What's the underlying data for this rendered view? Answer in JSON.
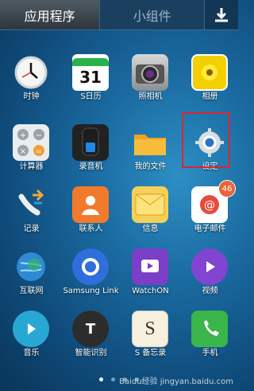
{
  "tabs": [
    "应用程序",
    "小组件"
  ],
  "apps": [
    {
      "label": "时钟",
      "icon": "clock-icon"
    },
    {
      "label": "S日历",
      "icon": "calendar-icon",
      "icon_text": "31"
    },
    {
      "label": "照相机",
      "icon": "camera-icon"
    },
    {
      "label": "相册",
      "icon": "gallery-icon"
    },
    {
      "label": "计算器",
      "icon": "calculator-icon"
    },
    {
      "label": "录音机",
      "icon": "recorder-icon"
    },
    {
      "label": "我的文件",
      "icon": "folder-icon"
    },
    {
      "label": "设定",
      "icon": "settings-icon"
    },
    {
      "label": "记录",
      "icon": "call-log-icon"
    },
    {
      "label": "联系人",
      "icon": "contacts-icon"
    },
    {
      "label": "信息",
      "icon": "messages-icon"
    },
    {
      "label": "电子邮件",
      "icon": "email-icon",
      "badge": "46"
    },
    {
      "label": "互联网",
      "icon": "internet-icon"
    },
    {
      "label": "Samsung Link",
      "icon": "samsung-link-icon"
    },
    {
      "label": "WatchON",
      "icon": "watchon-icon"
    },
    {
      "label": "视频",
      "icon": "video-icon"
    },
    {
      "label": "音乐",
      "icon": "music-icon"
    },
    {
      "label": "智能识别",
      "icon": "smart-recognition-icon",
      "icon_text": "T"
    },
    {
      "label": "S 备忘录",
      "icon": "memo-icon",
      "icon_text": "S"
    },
    {
      "label": "手机",
      "icon": "phone-icon"
    }
  ],
  "watermark": "Baidu经验 jingyan.baidu.com",
  "colors": {
    "highlight": "#d8282f",
    "accent": "#3a8fd6"
  }
}
